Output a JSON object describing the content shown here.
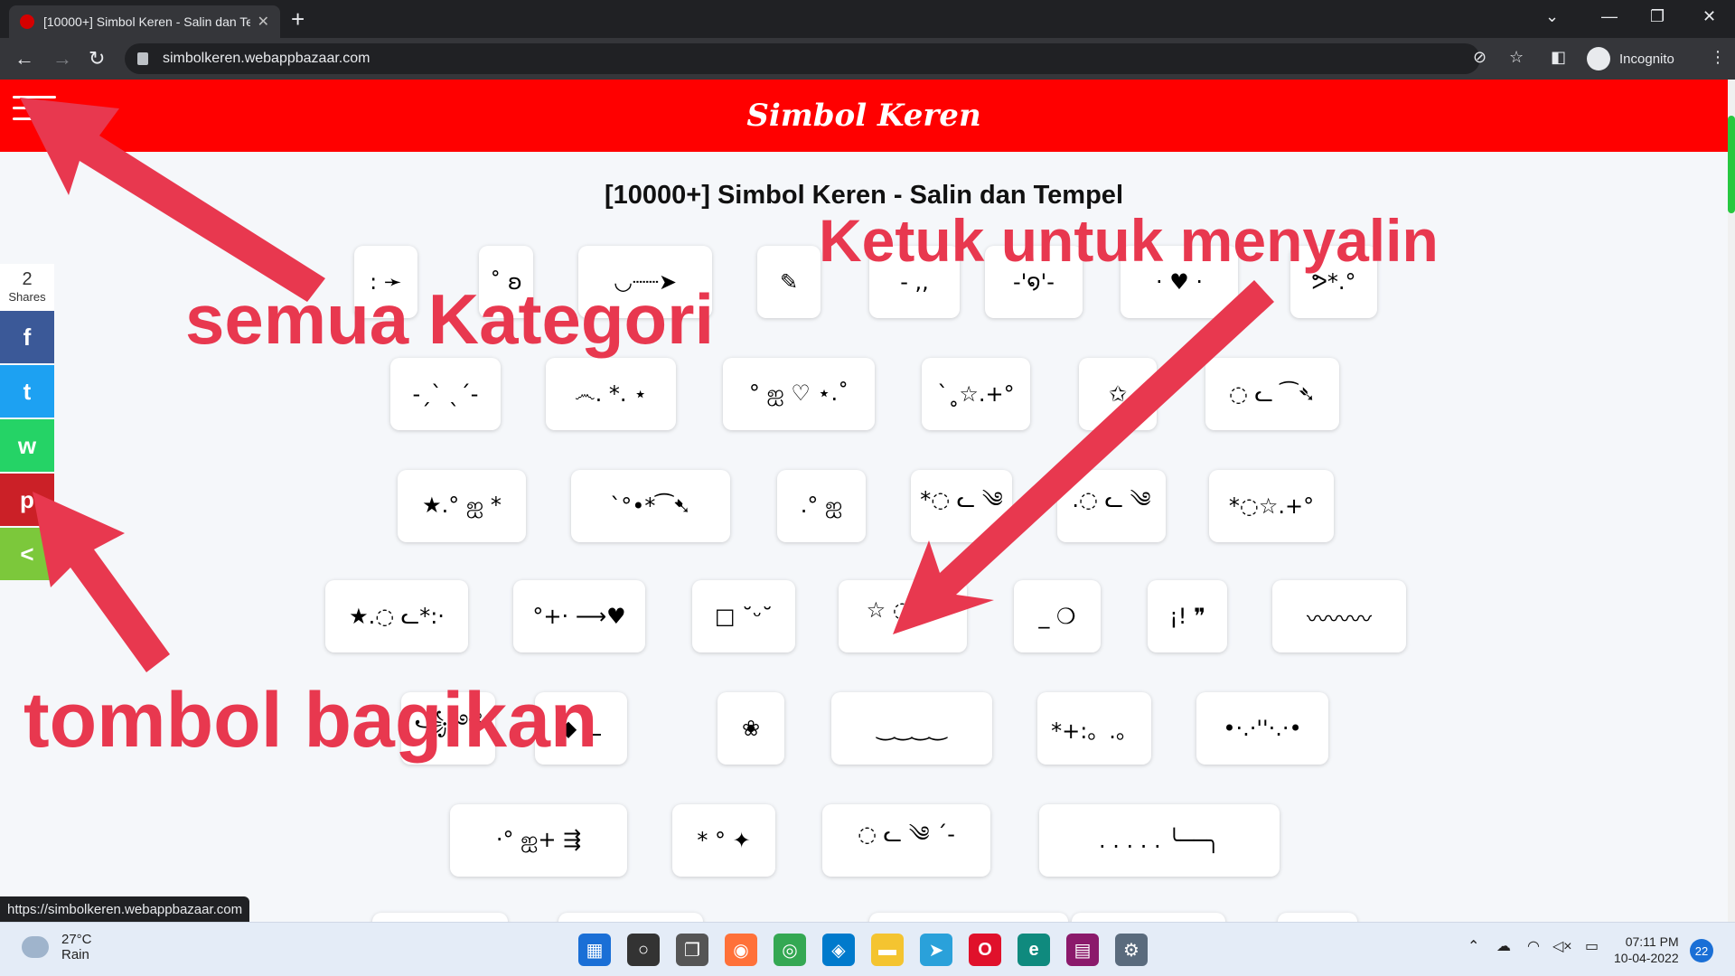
{
  "browser": {
    "tab_title": "[10000+] Simbol Keren - Salin dan Tempel",
    "new_tab": "+",
    "url": "simbolkeren.webappbazaar.com",
    "profile_label": "Incognito",
    "status_url": "https://simbolkeren.webappbazaar.com",
    "icons": {
      "back": "back-arrow-icon",
      "forward": "forward-arrow-icon",
      "reload": "reload-icon"
    }
  },
  "site": {
    "brand": "Simbol Keren",
    "title": "[10000+] Simbol Keren - Salin dan Tempel",
    "header_color": "#ff0000"
  },
  "share": {
    "count": "2",
    "label": "Shares",
    "buttons": [
      {
        "name": "facebook",
        "glyph": "f",
        "color": "#3b5998"
      },
      {
        "name": "twitter",
        "glyph": "t",
        "color": "#1da1f2"
      },
      {
        "name": "whatsapp",
        "glyph": "w",
        "color": "#25d366"
      },
      {
        "name": "pinterest",
        "glyph": "p",
        "color": "#cb2027"
      },
      {
        "name": "share",
        "glyph": "<",
        "color": "#7cc83b"
      }
    ]
  },
  "symbols": [
    ": ➛",
    "˚ ʚ",
    "◡┈┈➤",
    "✎",
    "- ,,",
    "-'໑'-",
    "· ♥ ·",
    "ᕗ*.°",
    "-ˏˋ ˎˊ-",
    "෴. *. ⋆",
    "° ஐ ♡ ⋆.˚",
    "ˋ˳☆.+°",
    "✩",
    "◌ ᓚ ⁀➴",
    "★.° ஐ *",
    "ˋ°•*⁀➷",
    ".° ஐ",
    "*◌ ᓚ ༄",
    ".◌ ᓚ ༄",
    "*◌☆.+°",
    "★.◌ ᓚ*:·",
    "°+· ⟶♥",
    "□ ˘ᵕ˘",
    "☆ ◌ ༄",
    "_ ❍",
    "¡! ❞",
    "〰〰〰",
    "꧁༺",
    "◆ ᓚ",
    "❀",
    "‿‿‿‿",
    "*+:。.。",
    "•·.·''·.·•",
    "·° ஐ+ ⇶",
    "* ° ✦",
    "◌ ᓚ ༄ ˊ-",
    ". . . . .  ╰──╮"
  ],
  "annotations": {
    "categories": "semua Kategori",
    "tap_to_copy": "Ketuk untuk menyalin",
    "share_buttons": "tombol bagikan",
    "color": "#e8384f"
  },
  "taskbar": {
    "temperature": "27°C",
    "condition": "Rain",
    "time": "07:11 PM",
    "date": "10-04-2022",
    "notifications": "22",
    "apps": [
      "start-icon",
      "search-icon",
      "task-view-icon",
      "firefox-icon",
      "chrome-icon",
      "vscode-icon",
      "file-explorer-icon",
      "telegram-icon",
      "opera-icon",
      "edge-icon",
      "winrar-icon",
      "settings-icon"
    ]
  }
}
